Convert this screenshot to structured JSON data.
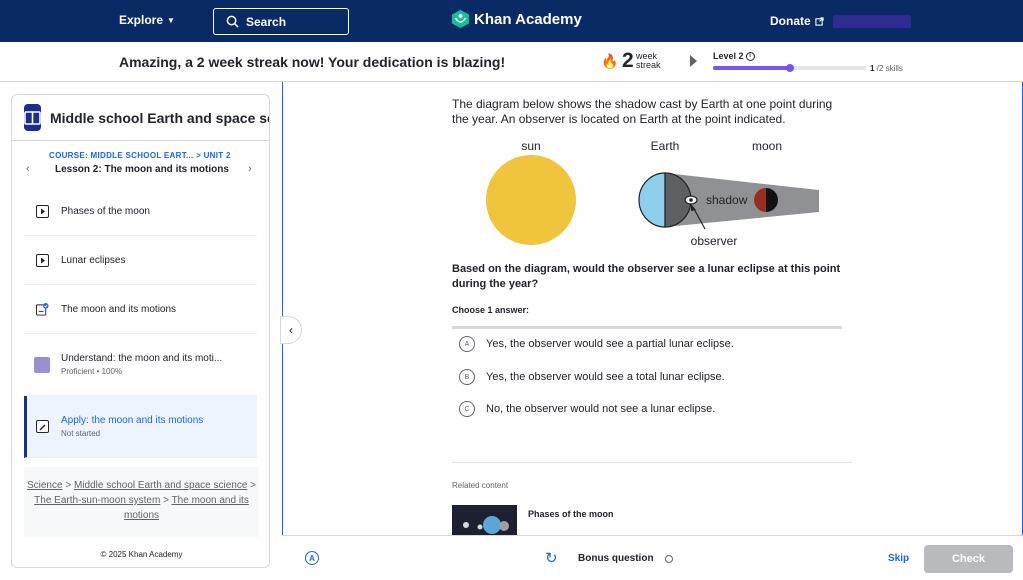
{
  "nav": {
    "explore": "Explore",
    "search_placeholder": "Search",
    "logo_text": "Khan Academy",
    "donate": "Donate"
  },
  "streak": {
    "message": "Amazing, a 2 week streak now! Your dedication is blazing!",
    "count": "2",
    "unit_line1": "week",
    "unit_line2": "streak",
    "level": "Level 2",
    "level_progress": 0.5,
    "skills_done": "1",
    "skills_total": "/2 skills"
  },
  "sidebar": {
    "course_title": "Middle school Earth and space sc...",
    "crumb_course": "COURSE: MIDDLE SCHOOL EART...",
    "crumb_unit": "> UNIT 2",
    "lesson_title": "Lesson 2: The moon and its motions",
    "items": [
      {
        "label": "Phases of the moon",
        "sub": ""
      },
      {
        "label": "Lunar eclipses",
        "sub": ""
      },
      {
        "label": "The moon and its motions",
        "sub": ""
      },
      {
        "label": "Understand: the moon and its moti...",
        "sub": "Proficient • 100%"
      },
      {
        "label": "Apply: the moon and its motions",
        "sub": "Not started"
      }
    ],
    "breadcrumb": {
      "science": "Science",
      "course": "Middle school Earth and space science",
      "unit": "The Earth-sun-moon system",
      "lesson": "The moon and its motions",
      "sep": ">"
    },
    "copyright": "© 2025 Khan Academy"
  },
  "question": {
    "text": "The diagram below shows the shadow cast by Earth at one point during the year. An observer is located on Earth at the point indicated.",
    "diagram": {
      "sun": "sun",
      "earth": "Earth",
      "moon": "moon",
      "shadow": "shadow",
      "observer": "observer"
    },
    "prompt": "Based on the diagram, would the observer see a lunar eclipse at this point during the year?",
    "choose": "Choose 1 answer:",
    "choices": [
      {
        "letter": "A",
        "text": "Yes, the observer would see a partial lunar eclipse."
      },
      {
        "letter": "B",
        "text": "Yes, the observer would see a total lunar eclipse."
      },
      {
        "letter": "C",
        "text": "No, the observer would not see a lunar eclipse."
      }
    ]
  },
  "related": {
    "heading": "Related content",
    "title": "Phases of the moon"
  },
  "footer": {
    "a11y": "A",
    "bonus": "Bonus question",
    "skip": "Skip",
    "check": "Check"
  },
  "colors": {
    "nav_bg": "#0a2a66",
    "accent": "#1865f2",
    "progress": "#7854f7",
    "sun": "#f0c43c",
    "earth_day": "#8ecfee",
    "moon_red": "#9b2d1f"
  }
}
